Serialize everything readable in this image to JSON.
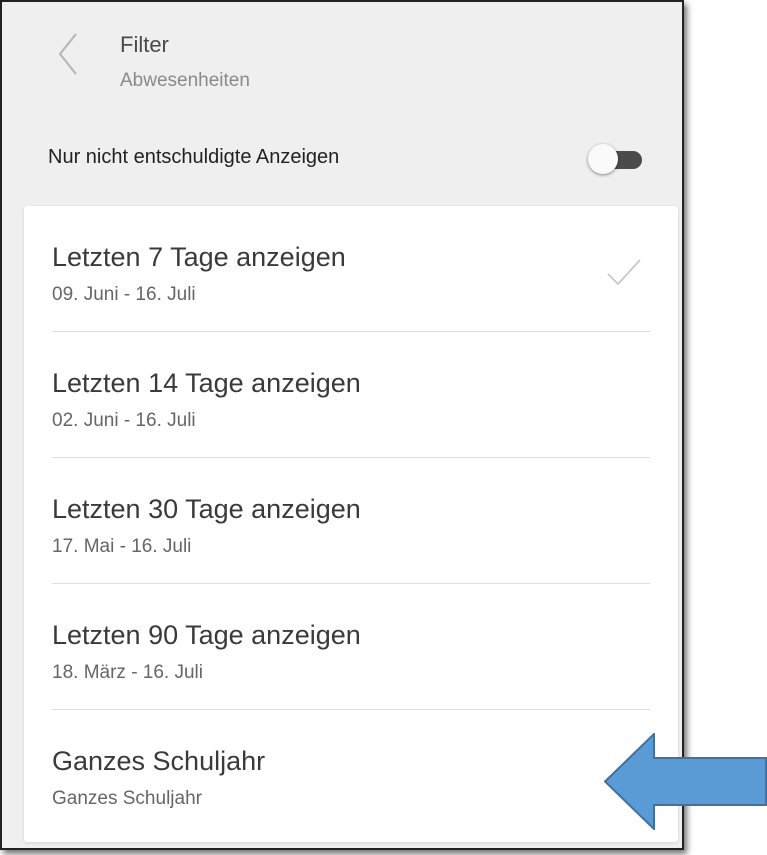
{
  "header": {
    "title": "Filter",
    "subtitle": "Abwesenheiten",
    "back_icon": "chevron-left-icon"
  },
  "toggle": {
    "label": "Nur nicht entschuldigte Anzeigen",
    "state": "off"
  },
  "options": [
    {
      "label": "Letzten 7 Tage anzeigen",
      "range": "09. Juni - 16. Juli",
      "selected": true
    },
    {
      "label": "Letzten 14 Tage anzeigen",
      "range": "02. Juni - 16. Juli",
      "selected": false
    },
    {
      "label": "Letzten 30 Tage anzeigen",
      "range": "17. Mai - 16. Juli",
      "selected": false
    },
    {
      "label": "Letzten 90 Tage anzeigen",
      "range": "18. März - 16. Juli",
      "selected": false
    },
    {
      "label": "Ganzes Schuljahr",
      "range": "Ganzes Schuljahr",
      "selected": false
    }
  ],
  "colors": {
    "background": "#efefef",
    "card": "#ffffff",
    "arrow_fill": "#5b9bd5",
    "arrow_stroke": "#41719c"
  }
}
